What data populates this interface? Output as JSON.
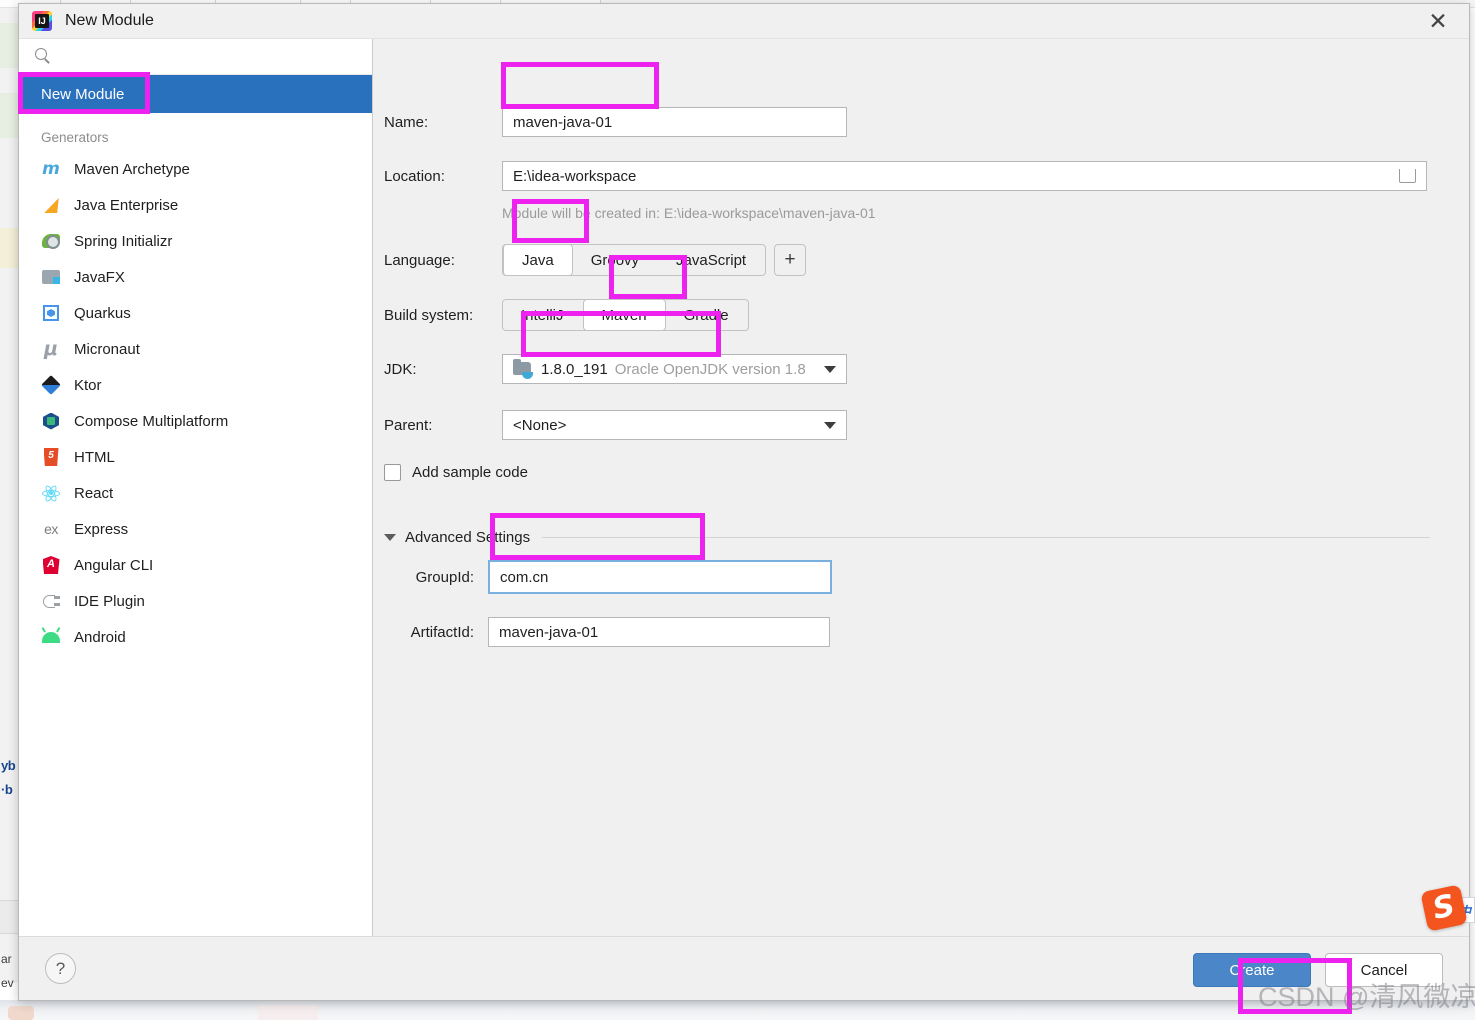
{
  "window": {
    "title": "New Module",
    "app_icon": "intellij-idea-icon",
    "close_label": "✕"
  },
  "sidebar": {
    "search": {
      "value": "",
      "placeholder": "",
      "icon": "search-icon"
    },
    "selected_item": "New Module",
    "group_label": "Generators",
    "items": [
      {
        "label": "Maven Archetype",
        "icon": "maven-icon"
      },
      {
        "label": "Java Enterprise",
        "icon": "java-enterprise-icon"
      },
      {
        "label": "Spring Initializr",
        "icon": "spring-icon"
      },
      {
        "label": "JavaFX",
        "icon": "javafx-icon"
      },
      {
        "label": "Quarkus",
        "icon": "quarkus-icon"
      },
      {
        "label": "Micronaut",
        "icon": "micronaut-icon"
      },
      {
        "label": "Ktor",
        "icon": "ktor-icon"
      },
      {
        "label": "Compose Multiplatform",
        "icon": "compose-icon"
      },
      {
        "label": "HTML",
        "icon": "html5-icon"
      },
      {
        "label": "React",
        "icon": "react-icon"
      },
      {
        "label": "Express",
        "icon": "express-icon"
      },
      {
        "label": "Angular CLI",
        "icon": "angular-icon"
      },
      {
        "label": "IDE Plugin",
        "icon": "ide-plugin-icon"
      },
      {
        "label": "Android",
        "icon": "android-icon"
      }
    ]
  },
  "form": {
    "name": {
      "label": "Name:",
      "value": "maven-java-01"
    },
    "location": {
      "label": "Location:",
      "value": "E:\\idea-workspace",
      "browse_icon": "folder-browse-icon"
    },
    "location_hint": "Module will be created in: E:\\idea-workspace\\maven-java-01",
    "language": {
      "label": "Language:",
      "options": [
        "Java",
        "Groovy",
        "JavaScript"
      ],
      "selected": "Java",
      "add_label": "+"
    },
    "build_system": {
      "label": "Build system:",
      "options": [
        "IntelliJ",
        "Maven",
        "Gradle"
      ],
      "selected": "Maven"
    },
    "jdk": {
      "label": "JDK:",
      "version": "1.8.0_191",
      "description": "Oracle OpenJDK version 1.8",
      "icon": "jdk-folder-icon"
    },
    "parent": {
      "label": "Parent:",
      "value": "<None>"
    },
    "add_sample_code": {
      "label": "Add sample code",
      "checked": false
    },
    "advanced": {
      "title": "Advanced Settings",
      "expanded": true,
      "group_id": {
        "label": "GroupId:",
        "value": "com.cn"
      },
      "artifact_id": {
        "label": "ArtifactId:",
        "value": "maven-java-01"
      }
    }
  },
  "footer": {
    "help_label": "?",
    "create_label": "Create",
    "cancel_label": "Cancel"
  },
  "overlay": {
    "watermark": "CSDN @清风微凉. aaa",
    "annotation_color": "#ee22ee",
    "accent_blue": "#2a71bd",
    "button_blue": "#4a86c8",
    "focus_blue": "#7ab0e0"
  },
  "desktop": {
    "ime_icon": "sogou-ime-icon",
    "ime_letter": "S",
    "ime_toolbar_glyph": "中",
    "bg_left_fragments": [
      "yb",
      "·b",
      "ar",
      "ev"
    ]
  }
}
